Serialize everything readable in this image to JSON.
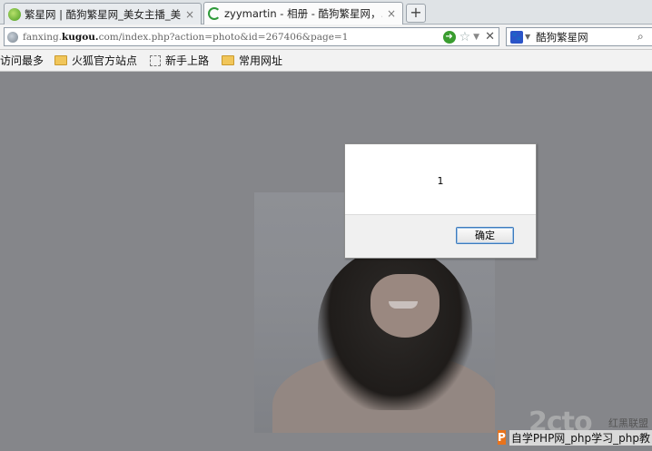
{
  "tabs": [
    {
      "label": "繁星网 | 酷狗繁星网_美女主播_美…",
      "active": false
    },
    {
      "label": "zyymartin - 相册 - 酷狗繁星网，…",
      "active": true
    }
  ],
  "new_tab_label": "+",
  "tab_close_glyph": "×",
  "address": {
    "prefix": "fanxing.",
    "domain": "kugou.",
    "suffix": "com/index.php?action=photo&id=267406&page=1"
  },
  "search": {
    "engine_value": "酷狗繁星网",
    "engine_glyph": "🐾"
  },
  "bookmarks": [
    {
      "label": "访问最多",
      "icon": "none"
    },
    {
      "label": "火狐官方站点",
      "icon": "folder-icon"
    },
    {
      "label": "新手上路",
      "icon": "blank-page-icon"
    },
    {
      "label": "常用网址",
      "icon": "folder-icon"
    }
  ],
  "dialog": {
    "message": "1",
    "ok_label": "确定"
  },
  "watermark": {
    "text": "自学PHP网_php学习_php教",
    "logo_text": "2cto",
    "side_text": "红黑联盟"
  },
  "colors": {
    "page_bg": "#85868a",
    "go_button": "#3a9d2f",
    "watermark_p": "#e8731c"
  }
}
